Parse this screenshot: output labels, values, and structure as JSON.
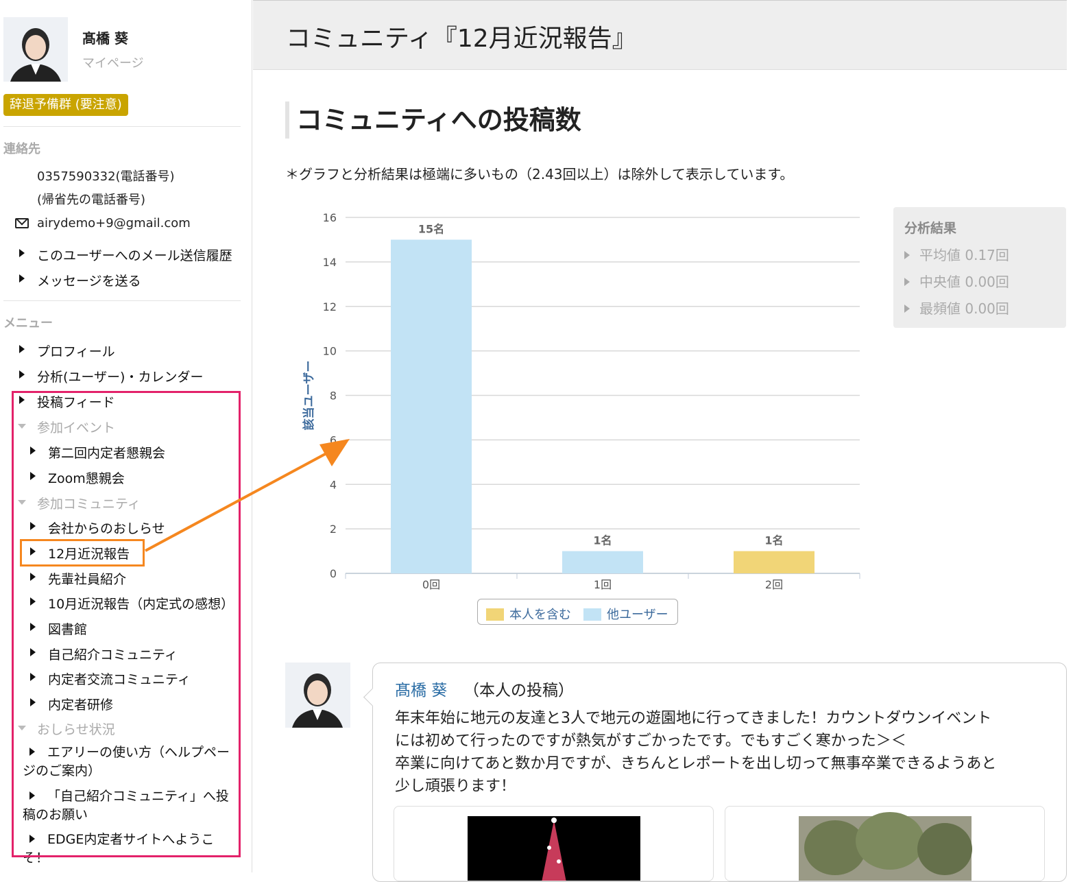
{
  "profile": {
    "name": "髙橋 葵",
    "mypage_label": "マイページ",
    "status_badge": "辞退予備群 (要注意)"
  },
  "contact": {
    "heading": "連絡先",
    "phone": "0357590332(電話番号)",
    "home_phone": "(帰省先の電話番号)",
    "email": "airydemo+9@gmail.com",
    "links": [
      "このユーザーへのメール送信履歴",
      "メッセージを送る"
    ]
  },
  "menu": {
    "heading": "メニュー",
    "top_items": [
      "プロフィール",
      "分析(ユーザー)・カレンダー",
      "投稿フィード"
    ],
    "events_label": "参加イベント",
    "events": [
      "第二回内定者懇親会",
      "Zoom懇親会"
    ],
    "communities_label": "参加コミュニティ",
    "communities": [
      "会社からのおしらせ",
      "12月近況報告",
      "先輩社員紹介",
      "10月近況報告（内定式の感想）",
      "図書館",
      "自己紹介コミュニティ",
      "内定者交流コミュニティ",
      "内定者研修"
    ],
    "notices_label": "おしらせ状況",
    "notices": [
      "エアリーの使い方（ヘルプページのご案内）",
      "「自己紹介コミュニティ」へ投稿のお願い",
      "EDGE内定者サイトへようこそ！"
    ]
  },
  "main": {
    "page_title": "コミュニティ『12月近況報告』",
    "section_heading": "コミュニティへの投稿数",
    "note": "＊グラフと分析結果は極端に多いもの（2.43回以上）は除外して表示しています。"
  },
  "analysis": {
    "title": "分析結果",
    "mean": "平均値 0.17回",
    "median": "中央値 0.00回",
    "mode": "最頻値 0.00回"
  },
  "chart_data": {
    "type": "bar",
    "categories": [
      "0回",
      "1回",
      "2回"
    ],
    "series": [
      {
        "name": "他ユーザー",
        "values": [
          15,
          1,
          0
        ],
        "color": "#c2e3f5"
      },
      {
        "name": "本人を含む",
        "values": [
          0,
          0,
          1
        ],
        "color": "#f1d577"
      }
    ],
    "data_labels": [
      "15名",
      "1名",
      "1名"
    ],
    "ylabel": "該当ユーザー",
    "ylim": [
      0,
      16
    ],
    "yticks": [
      "0",
      "2",
      "4",
      "6",
      "8",
      "10",
      "12",
      "14",
      "16"
    ],
    "grid": true,
    "legend_position": "bottom-center"
  },
  "legend": {
    "self_label": "本人を含む",
    "others_label": "他ユーザー"
  },
  "post": {
    "author": "髙橋 葵",
    "tag": "（本人の投稿）",
    "body_lines": [
      "年末年始に地元の友達と3人で地元の遊園地に行ってきました！カウントダウンイベント",
      "には初めて行ったのですが熱気がすごかったです。でもすごく寒かった＞＜",
      "卒業に向けてあと数か月ですが、きちんとレポートを出し切って無事卒業できるようあと",
      "少し頑張ります！"
    ]
  }
}
